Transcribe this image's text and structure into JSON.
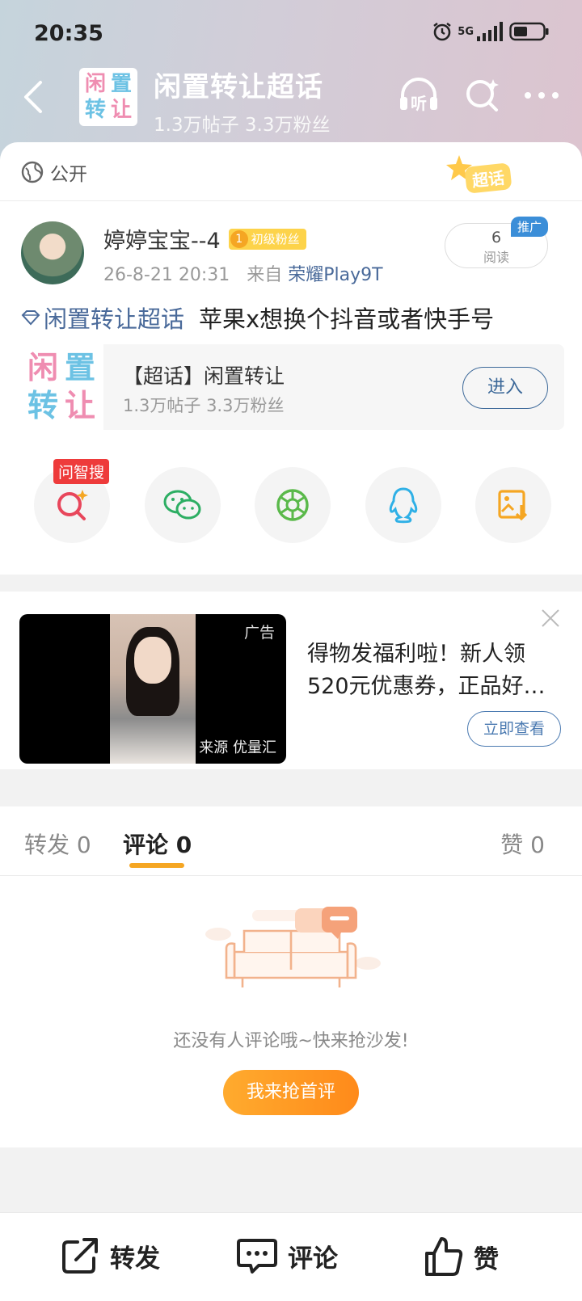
{
  "status_bar": {
    "time": "20:35",
    "network": "5G"
  },
  "header": {
    "title": "闲置转让超话",
    "stats": "1.3万帖子 3.3万粉丝",
    "logo_chars": [
      "闲",
      "置",
      "转",
      "让"
    ],
    "listen_label": "听"
  },
  "visibility": {
    "label": "公开"
  },
  "chaohua_badge": "超话",
  "post": {
    "author": "婷婷宝宝--4",
    "fan_level": "1",
    "fan_badge": "初级粉丝",
    "date": "26-8-21 20:31",
    "source_prefix": "来自",
    "source_device": "荣耀Play9T",
    "reads_count": "6",
    "reads_label": "阅读",
    "promo_label": "推广",
    "topic": "闲置转让超话",
    "content": "苹果x想换个抖音或者快手号"
  },
  "topic_card": {
    "name": "【超话】闲置转让",
    "stats": "1.3万帖子 3.3万粉丝",
    "enter_label": "进入"
  },
  "share": {
    "ask_badge": "问智搜"
  },
  "ad": {
    "label": "广告",
    "source": "来源 优量汇",
    "text": "得物发福利啦！新人领520元优惠券，正品好…",
    "cta": "立即查看"
  },
  "tabs": {
    "repost": "转发 0",
    "comment": "评论 0",
    "like": "赞 0"
  },
  "empty": {
    "message": "还没有人评论哦~快来抢沙发!",
    "button": "我来抢首评"
  },
  "bottom_bar": {
    "repost": "转发",
    "comment": "评论",
    "like": "赞"
  },
  "colors": {
    "accent_orange": "#f5a623",
    "link_blue": "#4a6a9a",
    "badge_red": "#ee3b3b"
  }
}
